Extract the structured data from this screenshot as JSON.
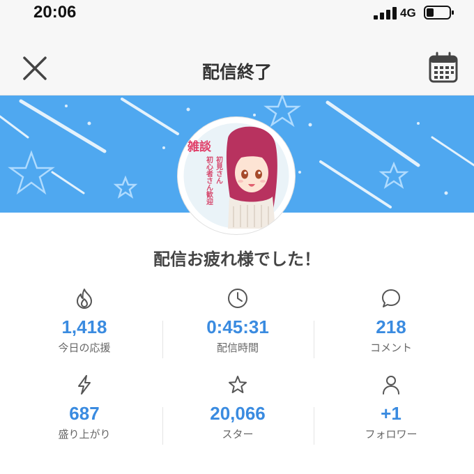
{
  "status_bar": {
    "time": "20:06",
    "network": "4G"
  },
  "header": {
    "title": "配信終了"
  },
  "avatar": {
    "tag": "雑談",
    "tagline_1": "初見さん",
    "tagline_2": "初心者さん歓迎"
  },
  "message": "配信お疲れ様でした！",
  "stats": [
    {
      "icon": "flame-icon",
      "value": "1,418",
      "label": "今日の応援"
    },
    {
      "icon": "clock-icon",
      "value": "0:45:31",
      "label": "配信時間"
    },
    {
      "icon": "speech-bubble-icon",
      "value": "218",
      "label": "コメント"
    },
    {
      "icon": "lightning-icon",
      "value": "687",
      "label": "盛り上がり"
    },
    {
      "icon": "star-icon",
      "value": "20,066",
      "label": "スター"
    },
    {
      "icon": "person-icon",
      "value": "+1",
      "label": "フォロワー"
    }
  ],
  "colors": {
    "banner": "#4fa8f0",
    "accent": "#3a8be0",
    "header_bg": "#f7f7f7"
  }
}
